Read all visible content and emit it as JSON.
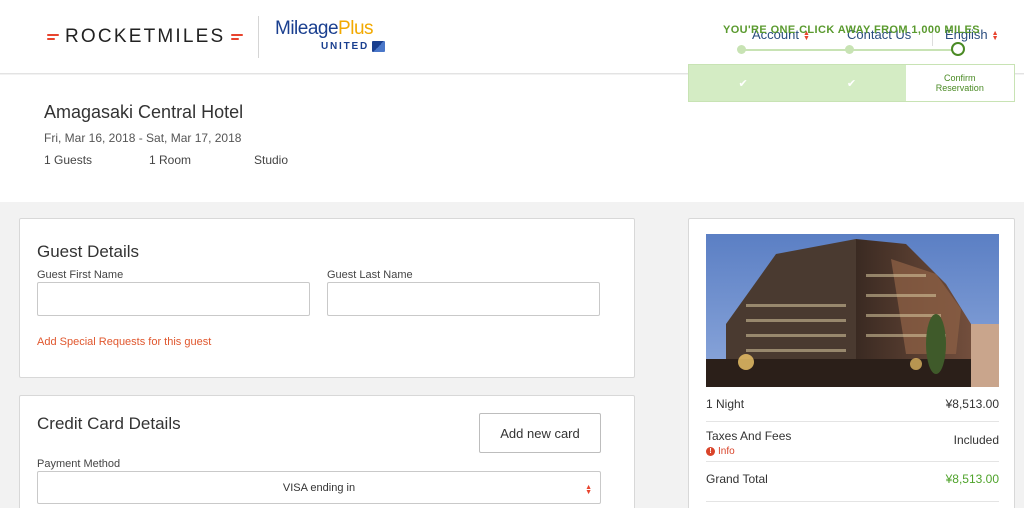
{
  "header": {
    "brand": "ROCKETMILES",
    "partner_main": "Mileage",
    "partner_plus": "Plus",
    "partner_sub": "UNITED",
    "nav": {
      "account": "Account",
      "contact": "Contact Us",
      "language": "English"
    }
  },
  "hotel": {
    "name": "Amagasaki Central Hotel",
    "dates": "Fri, Mar 16, 2018 - Sat, Mar 17, 2018",
    "guests": "1 Guests",
    "rooms": "1 Room",
    "room_type": "Studio"
  },
  "progress": {
    "title": "YOU'RE ONE CLICK AWAY FROM 1,000 MILES",
    "step1_mark": "✔",
    "step2_mark": "✔",
    "step3_label": "Confirm Reservation"
  },
  "guest_details": {
    "title": "Guest Details",
    "first_name_label": "Guest First Name",
    "first_name_value": "",
    "last_name_label": "Guest Last Name",
    "last_name_value": "",
    "special_requests_link": "Add Special Requests for this guest"
  },
  "credit_card": {
    "title": "Credit Card Details",
    "add_card_button": "Add new card",
    "payment_method_label": "Payment Method",
    "payment_method_value": "VISA ending in"
  },
  "pricing": {
    "night_label": "1 Night",
    "night_value": "¥8,513.00",
    "taxes_label": "Taxes And Fees",
    "taxes_value": "Included",
    "info_label": "Info",
    "total_label": "Grand Total",
    "total_value": "¥8,513.00"
  },
  "colors": {
    "accent_red": "#e8442e",
    "nav_blue": "#2a4d7e",
    "success_green": "#4fa32b",
    "progress_green": "#5a9a2e"
  }
}
